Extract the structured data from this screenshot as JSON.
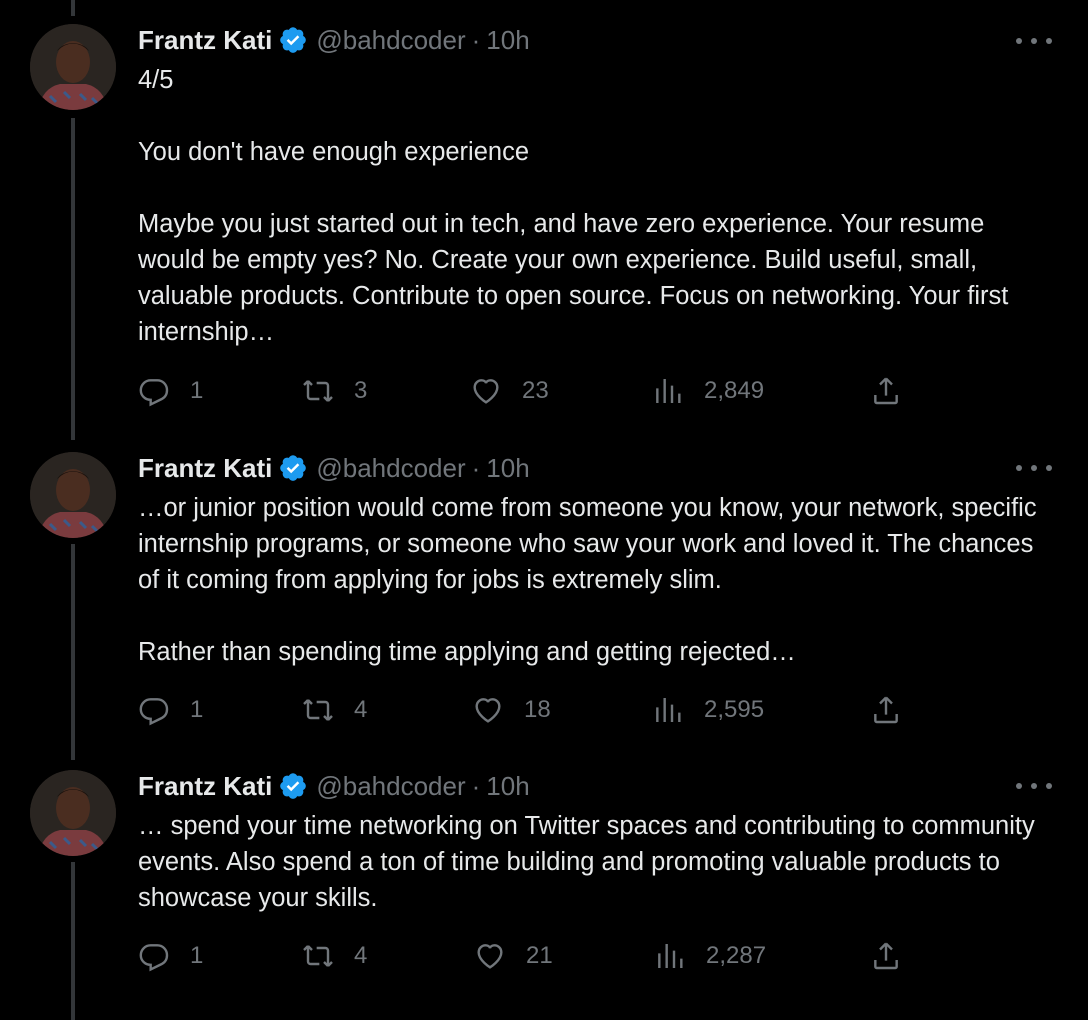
{
  "tweets": [
    {
      "author": "Frantz Kati",
      "handle": "@bahdcoder",
      "dot": "·",
      "time": "10h",
      "text": "4/5\n\nYou don't have enough experience\n\nMaybe you just started out in tech, and have zero experience. Your resume would be empty yes? No. Create your own experience. Build useful, small, valuable products. Contribute to open source. Focus on networking. Your first internship…",
      "replies": "1",
      "retweets": "3",
      "likes": "23",
      "views": "2,849"
    },
    {
      "author": "Frantz Kati",
      "handle": "@bahdcoder",
      "dot": "·",
      "time": "10h",
      "text": "…or junior position would come from someone you know, your network, specific internship programs, or someone who saw your work and loved it. The chances of it coming from applying for jobs is extremely slim.\n\nRather than spending time applying and getting rejected…",
      "replies": "1",
      "retweets": "4",
      "likes": "18",
      "views": "2,595"
    },
    {
      "author": "Frantz Kati",
      "handle": "@bahdcoder",
      "dot": "·",
      "time": "10h",
      "text": "… spend your time networking on Twitter spaces and contributing to community events. Also spend a ton of time building and promoting valuable products to showcase your skills.",
      "replies": "1",
      "retweets": "4",
      "likes": "21",
      "views": "2,287"
    }
  ],
  "icons": {
    "reply": "reply-icon",
    "retweet": "retweet-icon",
    "like": "heart-icon",
    "views": "views-icon",
    "share": "share-icon",
    "verified": "verified-badge-icon",
    "more": "more-icon"
  },
  "colors": {
    "background": "#000000",
    "text": "#e7e9ea",
    "secondary": "#71767b",
    "verified": "#1d9bf0",
    "thread_line": "#333639"
  }
}
